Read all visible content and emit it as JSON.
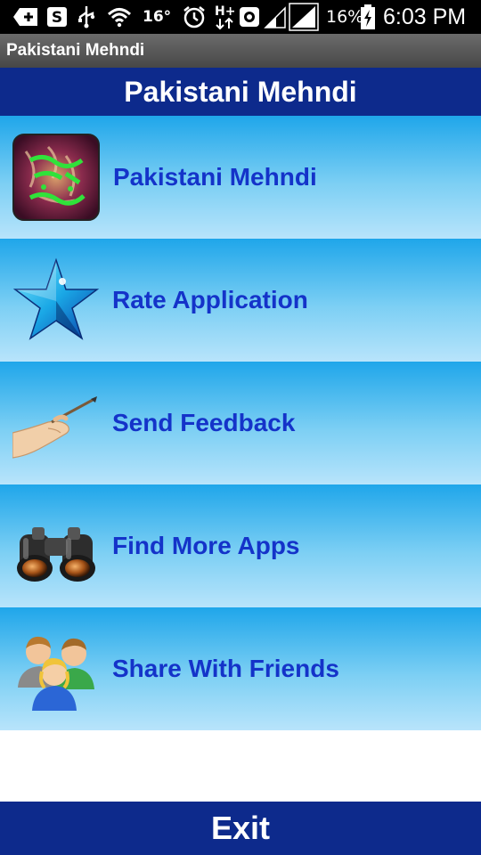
{
  "status_bar": {
    "temperature": "16°",
    "battery_percent": "16%",
    "time": "6:03 PM",
    "icons": [
      "add-icon",
      "skype-icon",
      "usb-icon",
      "wifi-icon",
      "alarm-icon",
      "hplus-data-icon",
      "browser-icon",
      "signal-icon",
      "signal-full-icon",
      "battery-charging-icon"
    ]
  },
  "app_bar": {
    "title": "Pakistani Mehndi"
  },
  "header": {
    "title": "Pakistani Mehndi"
  },
  "menu": {
    "items": [
      {
        "label": "Pakistani Mehndi",
        "icon": "mehndi-app-icon"
      },
      {
        "label": "Rate Application",
        "icon": "star-icon"
      },
      {
        "label": "Send Feedback",
        "icon": "hand-pen-icon"
      },
      {
        "label": "Find More Apps",
        "icon": "binoculars-icon"
      },
      {
        "label": "Share With Friends",
        "icon": "people-icon"
      }
    ]
  },
  "footer": {
    "exit_label": "Exit"
  },
  "colors": {
    "header_bg": "#0d2a8c",
    "row_gradient_top": "#1fa6ea",
    "row_gradient_bottom": "#b8e4fb",
    "label_color": "#1433c9"
  }
}
